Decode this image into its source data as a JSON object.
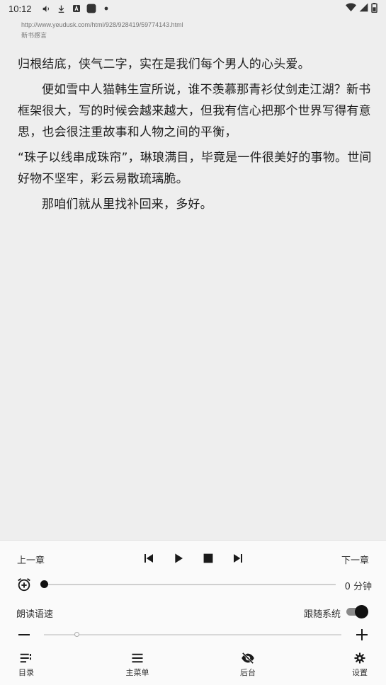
{
  "status_bar": {
    "time": "10:12",
    "left_icons": [
      "volume-icon",
      "download-icon",
      "a-badge-icon",
      "app-square-icon",
      "dot-icon"
    ],
    "right_icons": [
      "wifi-icon",
      "signal-icon",
      "battery-icon"
    ]
  },
  "header": {
    "url": "http://www.yeudusk.com/html/928/928419/59774143.html",
    "chapter_title": "新书感言"
  },
  "content": {
    "paragraphs": [
      "归根结底，侠气二字，实在是我们每个男人的心头爱。",
      "便如雪中人猫韩生宣所说，谁不羡慕那青衫仗剑走江湖？新书框架很大，写的时候会越来越大，但我有信心把那个世界写得有意思，也会很注重故事和人物之间的平衡，",
      "“珠子以线串成珠帘”，琳琅满目，毕竟是一件很美好的事物。世间好物不坚牢，彩云易散琉璃脆。",
      "那咱们就从里找补回来，多好。"
    ]
  },
  "player": {
    "prev_chapter": "上一章",
    "next_chapter": "下一章",
    "controls": [
      "skip-previous-icon",
      "play-icon",
      "stop-icon",
      "skip-next-icon"
    ],
    "timer_value": "0 分钟",
    "timer_progress": 0,
    "speed_label": "朗读语速",
    "follow_system_label": "跟随系统",
    "follow_system_enabled": true,
    "rate_progress": 0.1
  },
  "bottom_nav": {
    "items": [
      {
        "label": "目录",
        "icon": "toc-icon"
      },
      {
        "label": "主菜单",
        "icon": "menu-icon"
      },
      {
        "label": "后台",
        "icon": "eye-off-icon"
      },
      {
        "label": "设置",
        "icon": "gear-icon"
      }
    ]
  },
  "colors": {
    "page_background": "#eeeeee",
    "panel_background": "#fafafa",
    "text": "#1e1e1e",
    "accent": "#111111"
  }
}
